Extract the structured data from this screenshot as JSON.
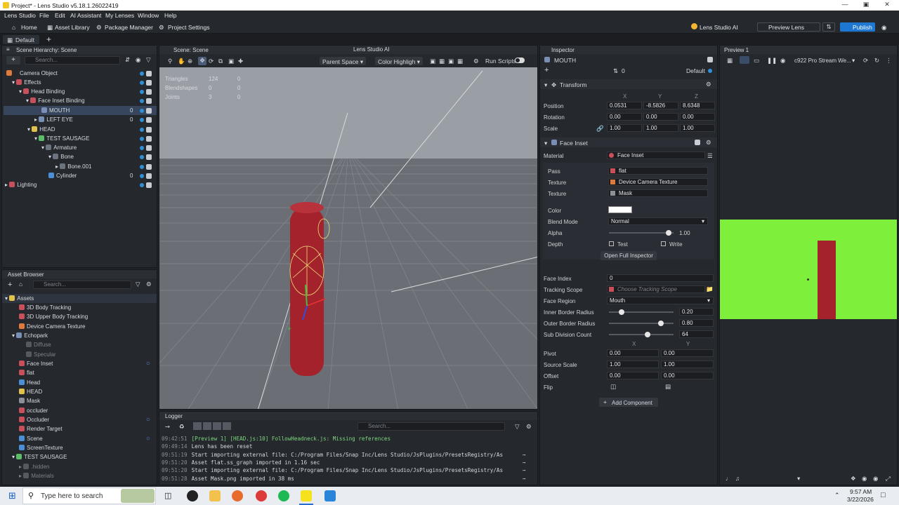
{
  "window": {
    "title": "Project* - Lens Studio v5.18.1.26022419"
  },
  "menu": [
    "Lens Studio",
    "File",
    "Edit",
    "AI Assistant",
    "My Lenses",
    "Window",
    "Help"
  ],
  "toolbar": {
    "home": "Home",
    "asset_library": "Asset Library",
    "package_manager": "Package Manager",
    "project_settings": "Project Settings",
    "lens_studio_ai": "Lens Studio AI",
    "preview_lens": "Preview Lens",
    "publish": "Publish"
  },
  "layout_tab": "Default",
  "hierarchy": {
    "title": "Scene Hierarchy: Scene",
    "search_placeholder": "Search...",
    "items": [
      {
        "label": "Camera Object",
        "count": ""
      },
      {
        "label": "Effects",
        "count": ""
      },
      {
        "label": "Head Binding",
        "count": ""
      },
      {
        "label": "Face Inset Binding",
        "count": ""
      },
      {
        "label": "MOUTH",
        "count": "0"
      },
      {
        "label": "LEFT EYE",
        "count": "0"
      },
      {
        "label": "HEAD",
        "count": ""
      },
      {
        "label": "TEST SAUSAGE",
        "count": ""
      },
      {
        "label": "Armature",
        "count": ""
      },
      {
        "label": "Bone",
        "count": ""
      },
      {
        "label": "Bone.001",
        "count": ""
      },
      {
        "label": "Cylinder",
        "count": "0"
      },
      {
        "label": "Lighting",
        "count": ""
      }
    ]
  },
  "asset_browser": {
    "title": "Asset Browser",
    "search_placeholder": "Search...",
    "items": [
      "Assets",
      "3D Body Tracking",
      "3D Upper Body Tracking",
      "Device Camera Texture",
      "Echopark",
      "Diffuse",
      "Specular",
      "Face Inset",
      "flat",
      "Head",
      "HEAD",
      "Mask",
      "occluder",
      "Occluder",
      "Render Target",
      "Scene",
      "ScreenTexture",
      "TEST SAUSAGE",
      ".hidden",
      "Materials"
    ]
  },
  "scene": {
    "title": "Scene: Scene",
    "ai_tab": "Lens Studio AI",
    "parent_space": "Parent Space",
    "color_highlight": "Color Highligh",
    "run_scripts": "Run Scripts",
    "stats": [
      {
        "label": "Triangles",
        "a": "124",
        "b": "0"
      },
      {
        "label": "Blendshapes",
        "a": "0",
        "b": "0"
      },
      {
        "label": "Joints",
        "a": "3",
        "b": "0"
      }
    ]
  },
  "logger": {
    "title": "Logger",
    "search_placeholder": "Search...",
    "lines": [
      {
        "time": "09:42:51",
        "text": "[Preview 1] [HEAD.js:10] FollowHeadneck.js: Missing references",
        "color": "#7dd87d"
      },
      {
        "time": "09:49:14",
        "text": "Lens has been reset",
        "color": "#d6d9de"
      },
      {
        "time": "09:51:19",
        "text": "Start importing external file: C:/Program Files/Snap Inc/Lens Studio/JsPlugins/PresetsRegistry/As",
        "color": "#d6d9de"
      },
      {
        "time": "09:51:20",
        "text": "Asset flat.ss_graph imported in 1.16 sec",
        "color": "#d6d9de"
      },
      {
        "time": "09:51:20",
        "text": "Start importing external file: C:/Program Files/Snap Inc/Lens Studio/JsPlugins/PresetsRegistry/As",
        "color": "#d6d9de"
      },
      {
        "time": "09:51:28",
        "text": "Asset Mask.png imported in 38 ms",
        "color": "#d6d9de"
      }
    ]
  },
  "inspector": {
    "title": "Inspector",
    "object_name": "MOUTH",
    "layer": "0",
    "layer_name": "Default",
    "transform": {
      "title": "Transform",
      "axes": [
        "X",
        "Y",
        "Z"
      ],
      "position": {
        "label": "Position",
        "x": "0.0531",
        "y": "-8.5826",
        "z": "8.6348"
      },
      "rotation": {
        "label": "Rotation",
        "x": "0.00",
        "y": "0.00",
        "z": "0.00"
      },
      "scale": {
        "label": "Scale",
        "x": "1.00",
        "y": "1.00",
        "z": "1.00"
      }
    },
    "face_inset": {
      "title": "Face Inset",
      "material_label": "Material",
      "material": "Face Inset",
      "pass_label": "Pass",
      "pass": "flat",
      "texture_label": "Texture",
      "texture1": "Device Camera Texture",
      "texture2": "Mask",
      "color_label": "Color",
      "blend_label": "Blend Mode",
      "blend": "Normal",
      "alpha_label": "Alpha",
      "alpha": "1.00",
      "alpha_frac": 0.92,
      "depth_label": "Depth",
      "test": "Test",
      "write": "Write",
      "open_full": "Open Full Inspector",
      "face_index_label": "Face Index",
      "face_index": "0",
      "tracking_label": "Tracking Scope",
      "tracking_placeholder": "Choose Tracking Scope",
      "region_label": "Face Region",
      "region": "Mouth",
      "inner_label": "Inner Border Radius",
      "inner": "0.20",
      "inner_frac": 0.2,
      "outer_label": "Outer Border Radius",
      "outer": "0.80",
      "outer_frac": 0.8,
      "subdiv_label": "Sub Division Count",
      "subdiv": "64",
      "subdiv_frac": 0.6,
      "xy": [
        "X",
        "Y"
      ],
      "pivot_label": "Pivot",
      "pivot_x": "0.00",
      "pivot_y": "0.00",
      "source_scale_label": "Source Scale",
      "ss_x": "1.00",
      "ss_y": "1.00",
      "offset_label": "Offset",
      "off_x": "0.00",
      "off_y": "0.00",
      "flip_label": "Flip"
    },
    "add_component": "Add Component"
  },
  "preview": {
    "title": "Preview 1",
    "device": "c922 Pro Stream We..."
  },
  "taskbar": {
    "search_placeholder": "Type here to search",
    "time": "9:57 AM",
    "date": "3/22/2026"
  },
  "colors": {
    "accent": "#2f8fd8",
    "panel": "#25282d",
    "preview_bg": "#7ef03c",
    "cylinder": "#a3222c"
  }
}
